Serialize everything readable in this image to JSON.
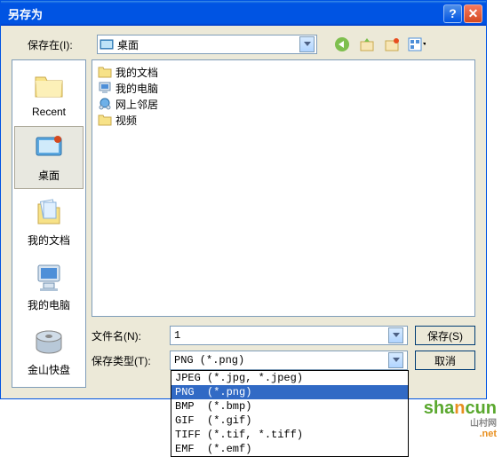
{
  "title": "另存为",
  "top": {
    "save_in_label": "保存在(I):",
    "location": "桌面"
  },
  "places": [
    {
      "key": "recent",
      "label": "Recent"
    },
    {
      "key": "desktop",
      "label": "桌面"
    },
    {
      "key": "mydocs",
      "label": "我的文档"
    },
    {
      "key": "mycomp",
      "label": "我的电脑"
    },
    {
      "key": "netdisk",
      "label": "金山快盘"
    }
  ],
  "files": [
    {
      "label": "我的文档",
      "icon": "folder"
    },
    {
      "label": "我的电脑",
      "icon": "computer"
    },
    {
      "label": "网上邻居",
      "icon": "network"
    },
    {
      "label": "视频",
      "icon": "folder"
    }
  ],
  "fields": {
    "filename_label": "文件名(N):",
    "filename_value": "1",
    "filetype_label": "保存类型(T):",
    "filetype_value": "PNG  (*.png)"
  },
  "dropdown": [
    "JPEG (*.jpg, *.jpeg)",
    "PNG  (*.png)",
    "BMP  (*.bmp)",
    "GIF  (*.gif)",
    "TIFF (*.tif, *.tiff)",
    "EMF  (*.emf)"
  ],
  "buttons": {
    "save": "保存(S)",
    "cancel": "取消"
  },
  "watermark": {
    "brand": "shancun",
    "sub": "山村网",
    "net": ".net"
  }
}
